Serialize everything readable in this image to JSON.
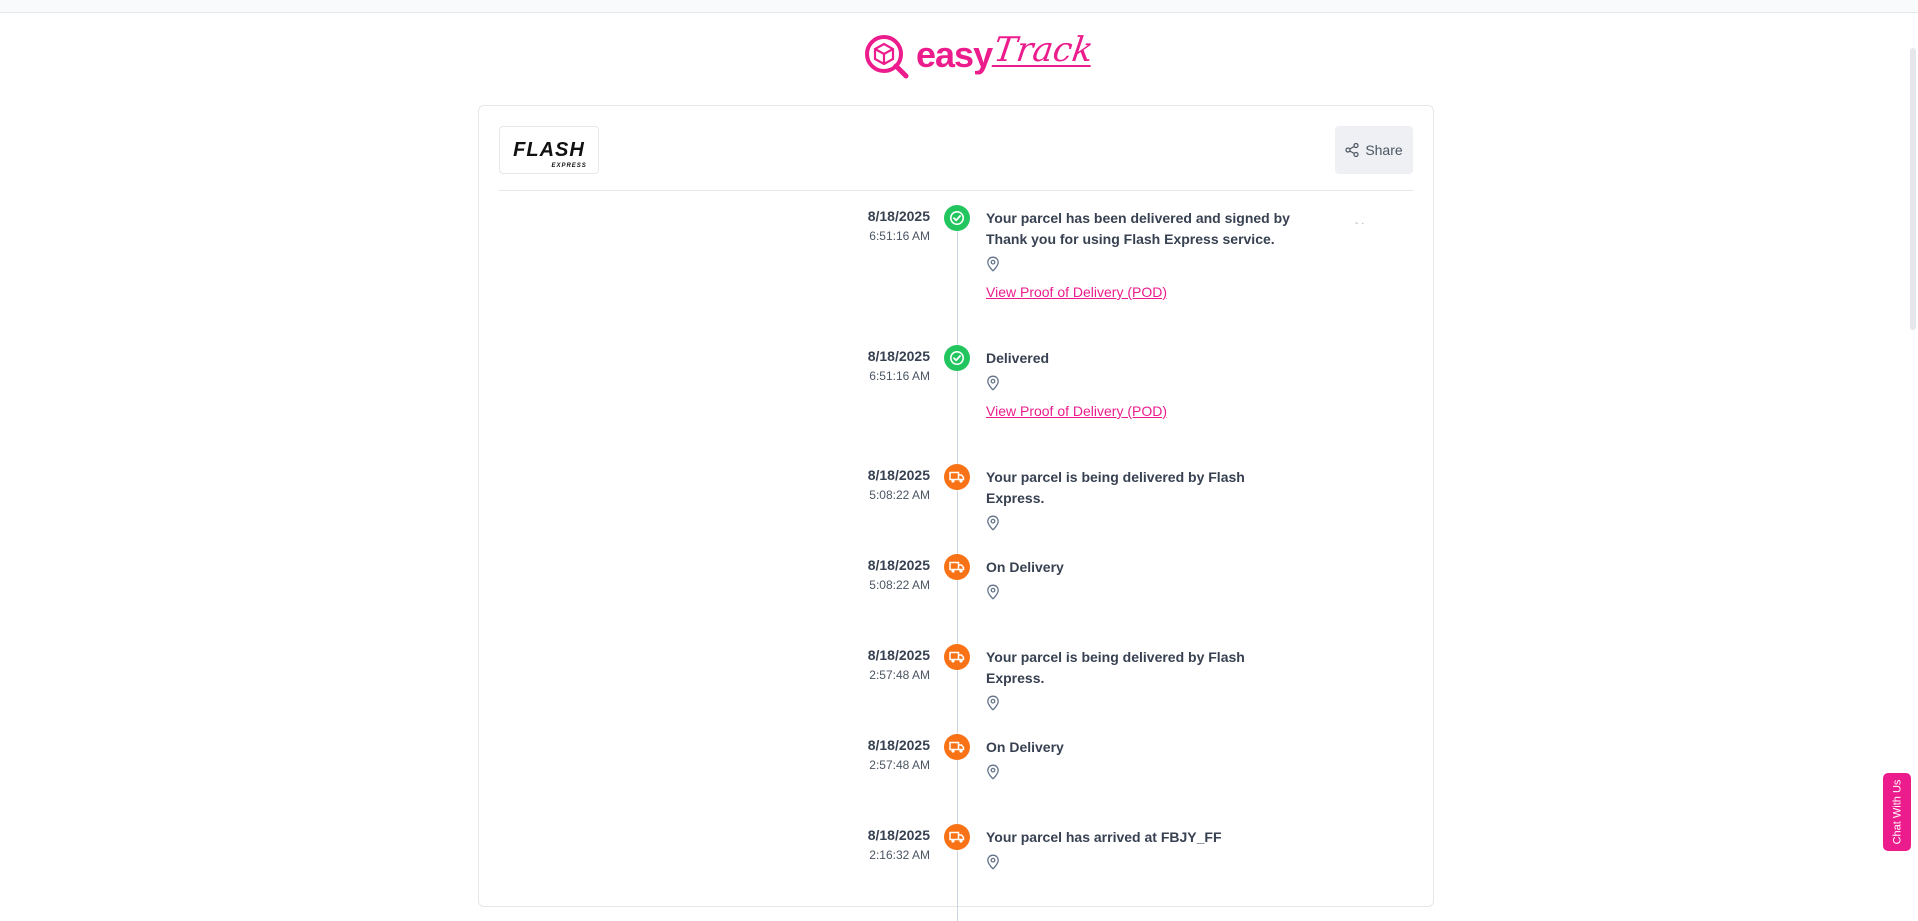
{
  "logo": {
    "part1": "easy",
    "part2": "Track"
  },
  "carrier": {
    "name": "FLASH",
    "sub": "EXPRESS"
  },
  "share_label": "Share",
  "events": [
    {
      "date": "8/18/2025",
      "time": "6:51:16 AM",
      "status": "delivered",
      "message": "Your parcel has been delivered and signed by Thank you for using Flash Express service.",
      "pod_label": "View Proof of Delivery (POD)"
    },
    {
      "date": "8/18/2025",
      "time": "6:51:16 AM",
      "status": "delivered",
      "message": "Delivered",
      "pod_label": "View Proof of Delivery (POD)"
    },
    {
      "date": "8/18/2025",
      "time": "5:08:22 AM",
      "status": "in-transit",
      "message": "Your parcel is being delivered by Flash Express."
    },
    {
      "date": "8/18/2025",
      "time": "5:08:22 AM",
      "status": "in-transit",
      "message": "On Delivery"
    },
    {
      "date": "8/18/2025",
      "time": "2:57:48 AM",
      "status": "in-transit",
      "message": "Your parcel is being delivered by Flash Express."
    },
    {
      "date": "8/18/2025",
      "time": "2:57:48 AM",
      "status": "in-transit",
      "message": "On Delivery"
    },
    {
      "date": "8/18/2025",
      "time": "2:16:32 AM",
      "status": "in-transit",
      "message": "Your parcel has arrived at FBJY_FF"
    }
  ],
  "chat_label": "Chat With Us",
  "colors": {
    "brand": "#ec1c8c",
    "delivered": "#22c55e",
    "in_transit": "#f97316"
  }
}
